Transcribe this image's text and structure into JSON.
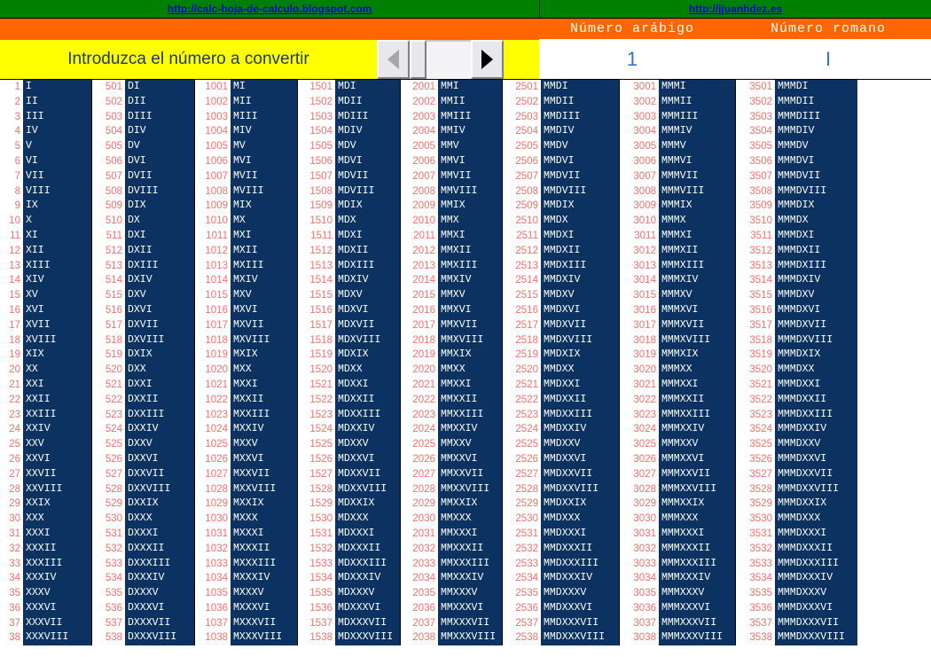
{
  "links": {
    "left_url": "http://calc-hoja-de-calculo.blogspot.com",
    "right_url": "http://jjuanhdez.es"
  },
  "header": {
    "arabic_label": "Número arábigo",
    "roman_label": "Número romano"
  },
  "prompt": {
    "text": "Introduzca el número a convertir",
    "spinner": {
      "left_arrow": "left-triangle-icon",
      "right_arrow": "right-triangle-icon",
      "left_enabled": false,
      "right_enabled": true
    }
  },
  "result": {
    "arabic_value": "1",
    "roman_value": "I",
    "value_color": "#2E75D4"
  },
  "colors": {
    "link_bar": "#008000",
    "link_text": "#0000EE",
    "orange": "#FF6600",
    "yellow": "#FFFF00",
    "navy": "#0B3260",
    "number_red": "#F4706C",
    "prompt_text": "#1F3864"
  },
  "table": {
    "columns": [
      {
        "start": 1,
        "roman_prefix": ""
      },
      {
        "start": 501,
        "roman_prefix": "D"
      },
      {
        "start": 1001,
        "roman_prefix": "M"
      },
      {
        "start": 1501,
        "roman_prefix": "MD"
      },
      {
        "start": 2001,
        "roman_prefix": "MM"
      },
      {
        "start": 2501,
        "roman_prefix": "MMD"
      },
      {
        "start": 3001,
        "roman_prefix": "MMM"
      },
      {
        "start": 3501,
        "roman_prefix": "MMMD"
      }
    ],
    "row_count": 38,
    "units": [
      "I",
      "II",
      "III",
      "IV",
      "V",
      "VI",
      "VII",
      "VIII",
      "IX",
      "X",
      "XI",
      "XII",
      "XIII",
      "XIV",
      "XV",
      "XVI",
      "XVII",
      "XVIII",
      "XIX",
      "XX",
      "XXI",
      "XXII",
      "XXIII",
      "XXIV",
      "XXV",
      "XXVI",
      "XXVII",
      "XXVIII",
      "XXIX",
      "XXX",
      "XXXI",
      "XXXII",
      "XXXIII",
      "XXXIV",
      "XXXV",
      "XXXVI",
      "XXXVII",
      "XXXVIII"
    ],
    "rows": [
      {
        "n": [
          1,
          501,
          1001,
          1501,
          2001,
          2501,
          3001,
          3501
        ],
        "r": [
          "I",
          "DI",
          "MI",
          "MDI",
          "MMI",
          "MMDI",
          "MMMI",
          "MMMDI"
        ]
      },
      {
        "n": [
          2,
          502,
          1002,
          1502,
          2002,
          2502,
          3002,
          3502
        ],
        "r": [
          "II",
          "DII",
          "MII",
          "MDII",
          "MMII",
          "MMDII",
          "MMMII",
          "MMMDII"
        ]
      },
      {
        "n": [
          3,
          503,
          1003,
          1503,
          2003,
          2503,
          3003,
          3503
        ],
        "r": [
          "III",
          "DIII",
          "MIII",
          "MDIII",
          "MMIII",
          "MMDIII",
          "MMMIII",
          "MMMDIII"
        ]
      },
      {
        "n": [
          4,
          504,
          1004,
          1504,
          2004,
          2504,
          3004,
          3504
        ],
        "r": [
          "IV",
          "DIV",
          "MIV",
          "MDIV",
          "MMIV",
          "MMDIV",
          "MMMIV",
          "MMMDIV"
        ]
      },
      {
        "n": [
          5,
          505,
          1005,
          1505,
          2005,
          2505,
          3005,
          3505
        ],
        "r": [
          "V",
          "DV",
          "MV",
          "MDV",
          "MMV",
          "MMDV",
          "MMMV",
          "MMMDV"
        ]
      },
      {
        "n": [
          6,
          506,
          1006,
          1506,
          2006,
          2506,
          3006,
          3506
        ],
        "r": [
          "VI",
          "DVI",
          "MVI",
          "MDVI",
          "MMVI",
          "MMDVI",
          "MMMVI",
          "MMMDVI"
        ]
      },
      {
        "n": [
          7,
          507,
          1007,
          1507,
          2007,
          2507,
          3007,
          3507
        ],
        "r": [
          "VII",
          "DVII",
          "MVII",
          "MDVII",
          "MMVII",
          "MMDVII",
          "MMMVII",
          "MMMDVII"
        ]
      },
      {
        "n": [
          8,
          508,
          1008,
          1508,
          2008,
          2508,
          3008,
          3508
        ],
        "r": [
          "VIII",
          "DVIII",
          "MVIII",
          "MDVIII",
          "MMVIII",
          "MMDVIII",
          "MMMVIII",
          "MMMDVIII"
        ]
      },
      {
        "n": [
          9,
          509,
          1009,
          1509,
          2009,
          2509,
          3009,
          3509
        ],
        "r": [
          "IX",
          "DIX",
          "MIX",
          "MDIX",
          "MMIX",
          "MMDIX",
          "MMMIX",
          "MMMDIX"
        ]
      },
      {
        "n": [
          10,
          510,
          1010,
          1510,
          2010,
          2510,
          3010,
          3510
        ],
        "r": [
          "X",
          "DX",
          "MX",
          "MDX",
          "MMX",
          "MMDX",
          "MMMX",
          "MMMDX"
        ]
      },
      {
        "n": [
          11,
          511,
          1011,
          1511,
          2011,
          2511,
          3011,
          3511
        ],
        "r": [
          "XI",
          "DXI",
          "MXI",
          "MDXI",
          "MMXI",
          "MMDXI",
          "MMMXI",
          "MMMDXI"
        ]
      },
      {
        "n": [
          12,
          512,
          1012,
          1512,
          2012,
          2512,
          3012,
          3512
        ],
        "r": [
          "XII",
          "DXII",
          "MXII",
          "MDXII",
          "MMXII",
          "MMDXII",
          "MMMXII",
          "MMMDXII"
        ]
      },
      {
        "n": [
          13,
          513,
          1013,
          1513,
          2013,
          2513,
          3013,
          3513
        ],
        "r": [
          "XIII",
          "DXIII",
          "MXIII",
          "MDXIII",
          "MMXIII",
          "MMDXIII",
          "MMMXIII",
          "MMMDXIII"
        ]
      },
      {
        "n": [
          14,
          514,
          1014,
          1514,
          2014,
          2514,
          3014,
          3514
        ],
        "r": [
          "XIV",
          "DXIV",
          "MXIV",
          "MDXIV",
          "MMXIV",
          "MMDXIV",
          "MMMXIV",
          "MMMDXIV"
        ]
      },
      {
        "n": [
          15,
          515,
          1015,
          1515,
          2015,
          2515,
          3015,
          3515
        ],
        "r": [
          "XV",
          "DXV",
          "MXV",
          "MDXV",
          "MMXV",
          "MMDXV",
          "MMMXV",
          "MMMDXV"
        ]
      },
      {
        "n": [
          16,
          516,
          1016,
          1516,
          2016,
          2516,
          3016,
          3516
        ],
        "r": [
          "XVI",
          "DXVI",
          "MXVI",
          "MDXVI",
          "MMXVI",
          "MMDXVI",
          "MMMXVI",
          "MMMDXVI"
        ]
      },
      {
        "n": [
          17,
          517,
          1017,
          1517,
          2017,
          2517,
          3017,
          3517
        ],
        "r": [
          "XVII",
          "DXVII",
          "MXVII",
          "MDXVII",
          "MMXVII",
          "MMDXVII",
          "MMMXVII",
          "MMMDXVII"
        ]
      },
      {
        "n": [
          18,
          518,
          1018,
          1518,
          2018,
          2518,
          3018,
          3518
        ],
        "r": [
          "XVIII",
          "DXVIII",
          "MXVIII",
          "MDXVIII",
          "MMXVIII",
          "MMDXVIII",
          "MMMXVIII",
          "MMMDXVIII"
        ]
      },
      {
        "n": [
          19,
          519,
          1019,
          1519,
          2019,
          2519,
          3019,
          3519
        ],
        "r": [
          "XIX",
          "DXIX",
          "MXIX",
          "MDXIX",
          "MMXIX",
          "MMDXIX",
          "MMMXIX",
          "MMMDXIX"
        ]
      },
      {
        "n": [
          20,
          520,
          1020,
          1520,
          2020,
          2520,
          3020,
          3520
        ],
        "r": [
          "XX",
          "DXX",
          "MXX",
          "MDXX",
          "MMXX",
          "MMDXX",
          "MMMXX",
          "MMMDXX"
        ]
      },
      {
        "n": [
          21,
          521,
          1021,
          1521,
          2021,
          2521,
          3021,
          3521
        ],
        "r": [
          "XXI",
          "DXXI",
          "MXXI",
          "MDXXI",
          "MMXXI",
          "MMDXXI",
          "MMMXXI",
          "MMMDXXI"
        ]
      },
      {
        "n": [
          22,
          522,
          1022,
          1522,
          2022,
          2522,
          3022,
          3522
        ],
        "r": [
          "XXII",
          "DXXII",
          "MXXII",
          "MDXXII",
          "MMXXII",
          "MMDXXII",
          "MMMXXII",
          "MMMDXXII"
        ]
      },
      {
        "n": [
          23,
          523,
          1023,
          1523,
          2023,
          2523,
          3023,
          3523
        ],
        "r": [
          "XXIII",
          "DXXIII",
          "MXXIII",
          "MDXXIII",
          "MMXXIII",
          "MMDXXIII",
          "MMMXXIII",
          "MMMDXXIII"
        ]
      },
      {
        "n": [
          24,
          524,
          1024,
          1524,
          2024,
          2524,
          3024,
          3524
        ],
        "r": [
          "XXIV",
          "DXXIV",
          "MXXIV",
          "MDXXIV",
          "MMXXIV",
          "MMDXXIV",
          "MMMXXIV",
          "MMMDXXIV"
        ]
      },
      {
        "n": [
          25,
          525,
          1025,
          1525,
          2025,
          2525,
          3025,
          3525
        ],
        "r": [
          "XXV",
          "DXXV",
          "MXXV",
          "MDXXV",
          "MMXXV",
          "MMDXXV",
          "MMMXXV",
          "MMMDXXV"
        ]
      },
      {
        "n": [
          26,
          526,
          1026,
          1526,
          2026,
          2526,
          3026,
          3526
        ],
        "r": [
          "XXVI",
          "DXXVI",
          "MXXVI",
          "MDXXVI",
          "MMXXVI",
          "MMDXXVI",
          "MMMXXVI",
          "MMMDXXVI"
        ]
      },
      {
        "n": [
          27,
          527,
          1027,
          1527,
          2027,
          2527,
          3027,
          3527
        ],
        "r": [
          "XXVII",
          "DXXVII",
          "MXXVII",
          "MDXXVII",
          "MMXXVII",
          "MMDXXVII",
          "MMMXXVII",
          "MMMDXXVII"
        ]
      },
      {
        "n": [
          28,
          528,
          1028,
          1528,
          2028,
          2528,
          3028,
          3528
        ],
        "r": [
          "XXVIII",
          "DXXVIII",
          "MXXVIII",
          "MDXXVIII",
          "MMXXVIII",
          "MMDXXVIII",
          "MMMXXVIII",
          "MMMDXXVIII"
        ]
      },
      {
        "n": [
          29,
          529,
          1029,
          1529,
          2029,
          2529,
          3029,
          3529
        ],
        "r": [
          "XXIX",
          "DXXIX",
          "MXXIX",
          "MDXXIX",
          "MMXXIX",
          "MMDXXIX",
          "MMMXXIX",
          "MMMDXXIX"
        ]
      },
      {
        "n": [
          30,
          530,
          1030,
          1530,
          2030,
          2530,
          3030,
          3530
        ],
        "r": [
          "XXX",
          "DXXX",
          "MXXX",
          "MDXXX",
          "MMXXX",
          "MMDXXX",
          "MMMXXX",
          "MMMDXXX"
        ]
      },
      {
        "n": [
          31,
          531,
          1031,
          1531,
          2031,
          2531,
          3031,
          3531
        ],
        "r": [
          "XXXI",
          "DXXXI",
          "MXXXI",
          "MDXXXI",
          "MMXXXI",
          "MMDXXXI",
          "MMMXXXI",
          "MMMDXXXI"
        ]
      },
      {
        "n": [
          32,
          532,
          1032,
          1532,
          2032,
          2532,
          3032,
          3532
        ],
        "r": [
          "XXXII",
          "DXXXII",
          "MXXXII",
          "MDXXXII",
          "MMXXXII",
          "MMDXXXII",
          "MMMXXXII",
          "MMMDXXXII"
        ]
      },
      {
        "n": [
          33,
          533,
          1033,
          1533,
          2033,
          2533,
          3033,
          3533
        ],
        "r": [
          "XXXIII",
          "DXXXIII",
          "MXXXIII",
          "MDXXXIII",
          "MMXXXIII",
          "MMDXXXIII",
          "MMMXXXIII",
          "MMMDXXXIII"
        ]
      },
      {
        "n": [
          34,
          534,
          1034,
          1534,
          2034,
          2534,
          3034,
          3534
        ],
        "r": [
          "XXXIV",
          "DXXXIV",
          "MXXXIV",
          "MDXXXIV",
          "MMXXXIV",
          "MMDXXXIV",
          "MMMXXXIV",
          "MMMDXXXIV"
        ]
      },
      {
        "n": [
          35,
          535,
          1035,
          1535,
          2035,
          2535,
          3035,
          3535
        ],
        "r": [
          "XXXV",
          "DXXXV",
          "MXXXV",
          "MDXXXV",
          "MMXXXV",
          "MMDXXXV",
          "MMMXXXV",
          "MMMDXXXV"
        ]
      },
      {
        "n": [
          36,
          536,
          1036,
          1536,
          2036,
          2536,
          3036,
          3536
        ],
        "r": [
          "XXXVI",
          "DXXXVI",
          "MXXXVI",
          "MDXXXVI",
          "MMXXXVI",
          "MMDXXXVI",
          "MMMXXXVI",
          "MMMDXXXVI"
        ]
      },
      {
        "n": [
          37,
          537,
          1037,
          1537,
          2037,
          2537,
          3037,
          3537
        ],
        "r": [
          "XXXVII",
          "DXXXVII",
          "MXXXVII",
          "MDXXXVII",
          "MMXXXVII",
          "MMDXXXVII",
          "MMMXXXVII",
          "MMMDXXXVII"
        ]
      },
      {
        "n": [
          38,
          538,
          1038,
          1538,
          2038,
          2538,
          3038,
          3538
        ],
        "r": [
          "XXXVIII",
          "DXXXVIII",
          "MXXXVIII",
          "MDXXXVIII",
          "MMXXXVIII",
          "MMDXXXVIII",
          "MMMXXXVIII",
          "MMMDXXXVIII"
        ]
      }
    ]
  }
}
